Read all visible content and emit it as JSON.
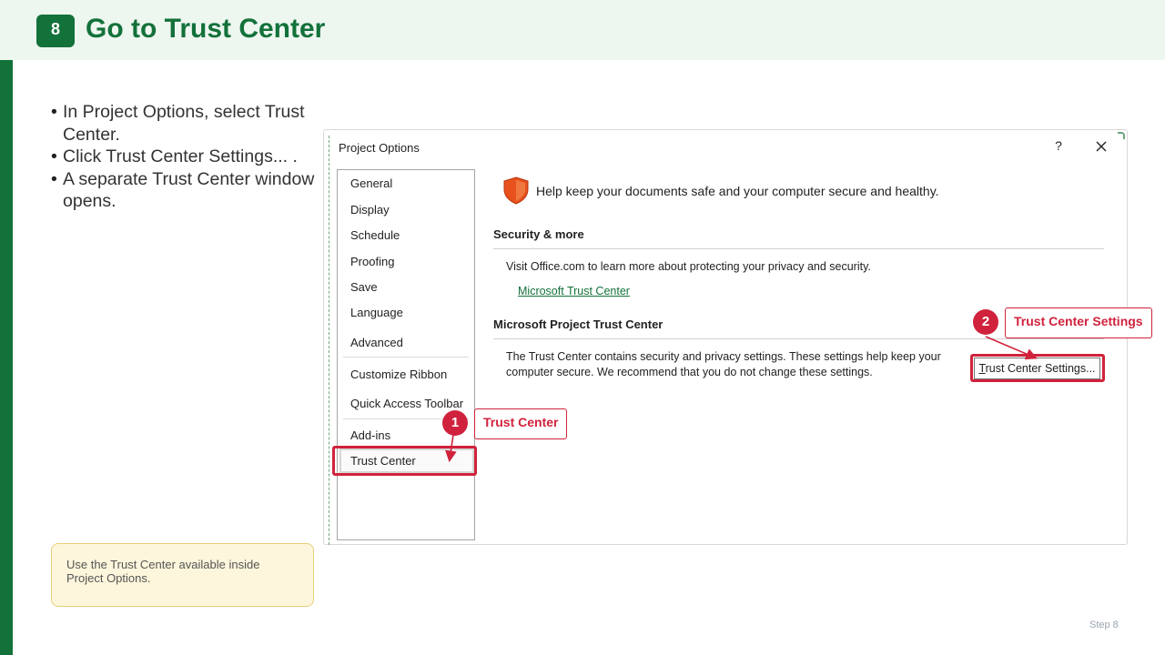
{
  "header": {
    "step_number": "8",
    "title": "Go to Trust Center"
  },
  "bullets": [
    "In Project Options, select Trust Center.",
    "Click Trust Center Settings... .",
    "A separate Trust Center window opens."
  ],
  "note": "Use the Trust Center available inside Project Options.",
  "footer": {
    "step_label": "Step 8"
  },
  "dialog": {
    "title": "Project Options",
    "help": "?",
    "nav_items": [
      "General",
      "Display",
      "Schedule",
      "Proofing",
      "Save",
      "Language",
      "Advanced",
      "Customize Ribbon",
      "Quick Access Toolbar",
      "Add-ins",
      "Trust Center"
    ],
    "selected_item": "Trust Center",
    "intro": "Help keep your documents safe and your computer secure and healthy.",
    "security_heading": "Security & more",
    "security_text": "Visit Office.com to learn more about protecting your privacy and security.",
    "link_text": "Microsoft Trust Center",
    "trust_heading": "Microsoft Project Trust Center",
    "trust_text_line1": "The Trust Center contains security and privacy settings. These settings help keep your",
    "trust_text_line2": "computer secure. We recommend that you do not change these settings.",
    "button_label_first": "T",
    "button_label_rest": "rust Center Settings..."
  },
  "callouts": [
    {
      "number": "1",
      "label": "Trust Center"
    },
    {
      "number": "2",
      "label": "Trust Center Settings"
    }
  ],
  "colors": {
    "brand_green": "#13713a",
    "callout_red": "#d0223c",
    "shield_orange": "#e8501c"
  },
  "icons": {
    "shield": "shield-icon",
    "close": "close-icon"
  }
}
